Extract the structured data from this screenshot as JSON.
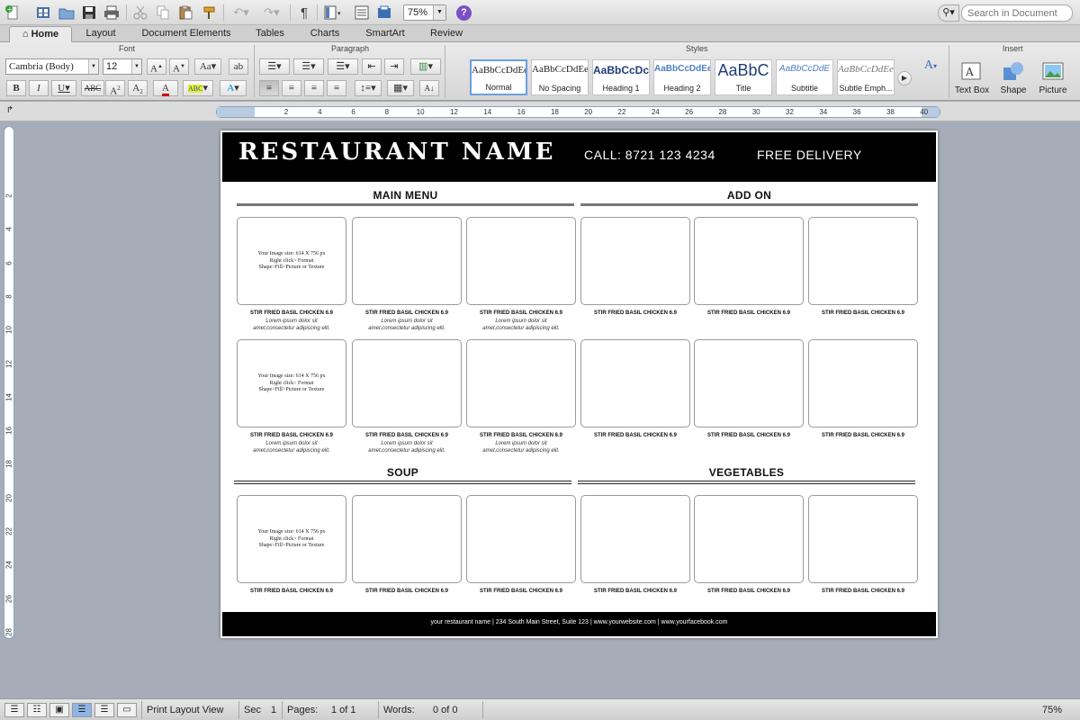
{
  "toolbar": {
    "zoom_value": "75%",
    "search_placeholder": "Search in Document",
    "help_glyph": "?"
  },
  "ribbon_tabs": [
    {
      "label": "Home"
    },
    {
      "label": "Layout"
    },
    {
      "label": "Document Elements"
    },
    {
      "label": "Tables"
    },
    {
      "label": "Charts"
    },
    {
      "label": "SmartArt"
    },
    {
      "label": "Review"
    }
  ],
  "ribbon": {
    "groups": {
      "font": "Font",
      "paragraph": "Paragraph",
      "styles": "Styles",
      "insert": "Insert"
    },
    "font_name": "Cambria (Body)",
    "font_size": "12",
    "styles": [
      {
        "sample": "AaBbCcDdEe",
        "name": "Normal"
      },
      {
        "sample": "AaBbCcDdEe",
        "name": "No Spacing"
      },
      {
        "sample": "AaBbCcDc",
        "name": "Heading 1"
      },
      {
        "sample": "AaBbCcDdEe",
        "name": "Heading 2"
      },
      {
        "sample": "AaBbC",
        "name": "Title"
      },
      {
        "sample": "AaBbCcDdE",
        "name": "Subtitle"
      },
      {
        "sample": "AaBbCcDdEe",
        "name": "Subtle Emph..."
      }
    ],
    "insert": [
      {
        "label": "Text Box"
      },
      {
        "label": "Shape"
      },
      {
        "label": "Picture"
      }
    ]
  },
  "ruler": {
    "h_numbers": [
      "2",
      "4",
      "6",
      "8",
      "10",
      "12",
      "14",
      "16",
      "18",
      "20",
      "22",
      "24",
      "26",
      "28",
      "30",
      "32",
      "34",
      "36",
      "38",
      "40"
    ],
    "v_numbers": [
      "2",
      "4",
      "6",
      "8",
      "10",
      "12",
      "14",
      "16",
      "18",
      "20",
      "22",
      "24",
      "26",
      "28"
    ]
  },
  "document": {
    "restaurant_name": "RESTAURANT NAME",
    "call": "CALL: 8721 123 4234",
    "delivery": "FREE DELIVERY",
    "sections": {
      "main_menu": "MAIN MENU",
      "add_on": "ADD ON",
      "soup": "SOUP",
      "vegetables": "VEGETABLES"
    },
    "placeholder": {
      "line1": "Your Image size: 614 X 756 px",
      "line2": "Right click> Format",
      "line3": "Shape>Fill>Picture or Texture"
    },
    "item_title": "STIR FRIED BASIL CHICKEN 6.9",
    "item_desc_1": "Lorem ipsum dolor sit",
    "item_desc_2": "amet,consectetur adipiscing elit.",
    "footer": "your restaurant name  |  234 South Main Street, Suite 123  |  www.yourwebsite.com  |  www.yourfacebook.com"
  },
  "statusbar": {
    "view": "Print Layout View",
    "sec_label": "Sec",
    "sec_value": "1",
    "pages_label": "Pages:",
    "pages_value": "1 of 1",
    "words_label": "Words:",
    "words_value": "0 of 0",
    "zoom": "75%"
  }
}
